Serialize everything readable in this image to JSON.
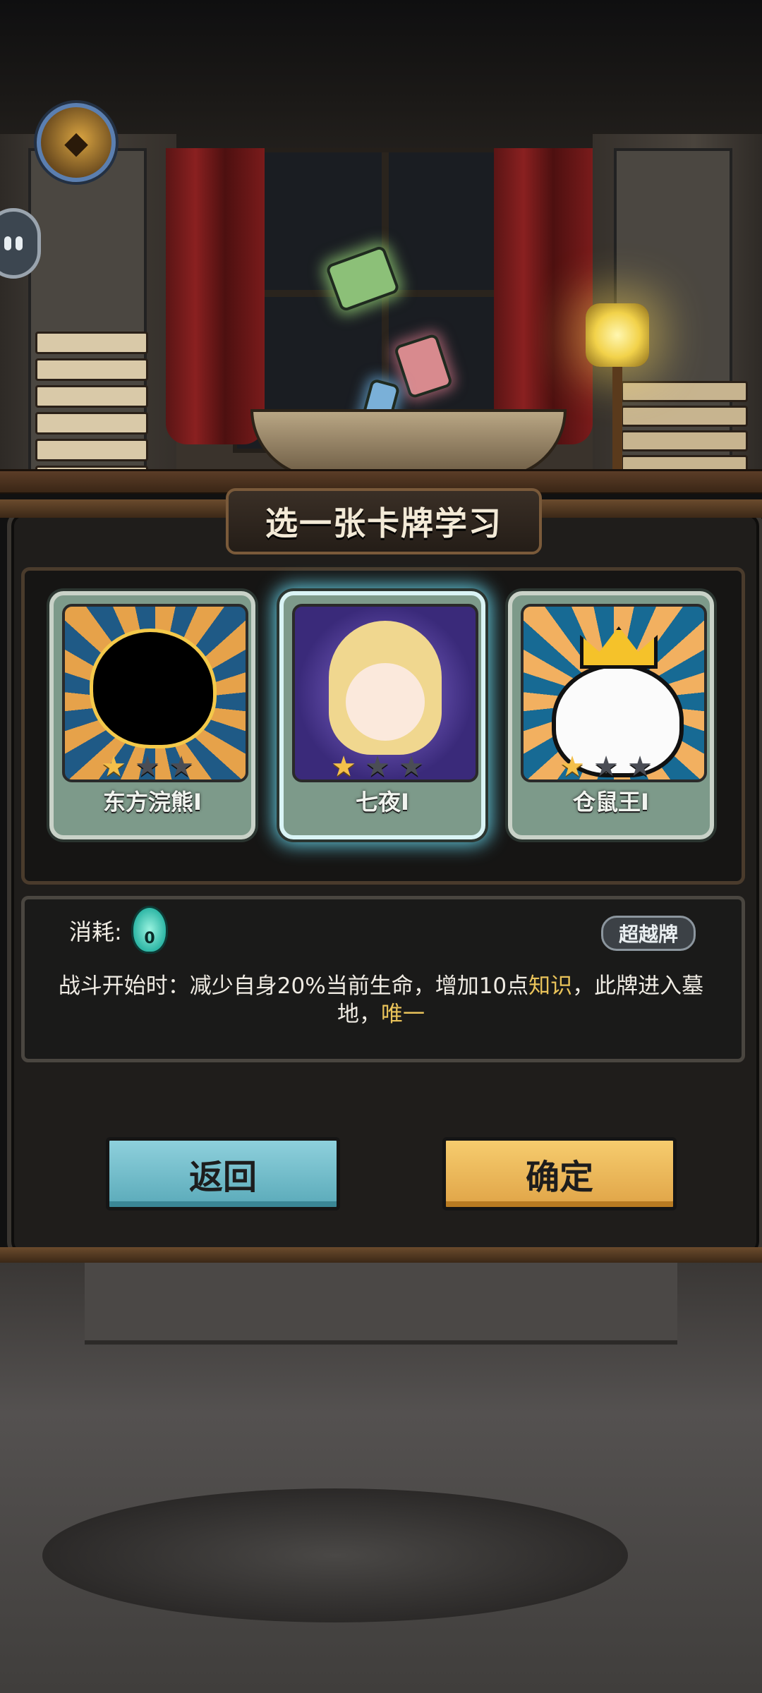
{
  "dialog": {
    "title": "选一张卡牌学习"
  },
  "cards": [
    {
      "name": "东方浣熊I",
      "stars_filled": 1,
      "stars_total": 3,
      "selected": false
    },
    {
      "name": "七夜I",
      "stars_filled": 1,
      "stars_total": 3,
      "selected": true
    },
    {
      "name": "仓鼠王I",
      "stars_filled": 1,
      "stars_total": 3,
      "selected": false
    }
  ],
  "details": {
    "cost_label": "消耗:",
    "cost_value": "0",
    "tag": "超越牌",
    "desc_part1": "战斗开始时：减少自身20%当前生命，增加10点",
    "desc_keyword1": "知识",
    "desc_part2": "，此牌进入墓地，",
    "desc_keyword2": "唯一"
  },
  "buttons": {
    "back": "返回",
    "confirm": "确定"
  },
  "colors": {
    "keyword": "#e9c35a",
    "back_button": "#6fbfcc",
    "confirm_button": "#eab659",
    "selected_glow": "#6ee6ff"
  },
  "icons": {
    "avatar": "player-avatar-icon",
    "chat": "chat-bubble-icon",
    "cost": "soul-flame-icon",
    "star": "star-icon"
  }
}
